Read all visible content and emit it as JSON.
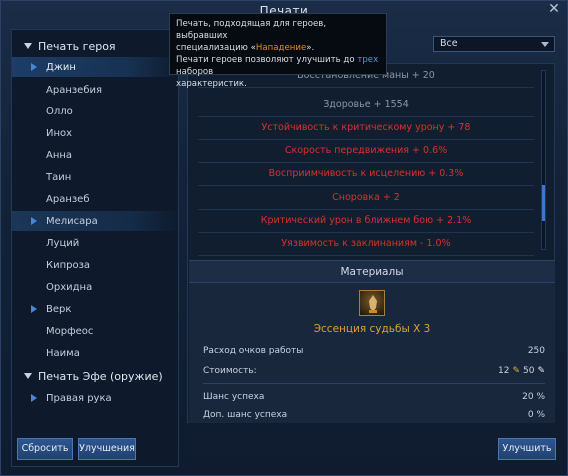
{
  "window": {
    "title": "Печати",
    "close_glyph": "✕"
  },
  "sidebar": {
    "groups": [
      {
        "label": "Печать героя"
      },
      {
        "label": "Печать Эфе (оружие)"
      }
    ],
    "items": [
      {
        "label": "Джин",
        "marked": true,
        "selected": true
      },
      {
        "label": "Аранзебия"
      },
      {
        "label": "Олло"
      },
      {
        "label": "Инох"
      },
      {
        "label": "Анна"
      },
      {
        "label": "Таин"
      },
      {
        "label": "Аранзеб"
      },
      {
        "label": "Мелисара",
        "marked": true
      },
      {
        "label": "Луций"
      },
      {
        "label": "Кипроза"
      },
      {
        "label": "Орхидна"
      },
      {
        "label": "Верк",
        "marked": true
      },
      {
        "label": "Морфеос"
      },
      {
        "label": "Наима"
      },
      {
        "label": "Правая рука",
        "marked": true
      }
    ]
  },
  "filter": {
    "selected": "Все"
  },
  "tooltip": {
    "line1": "Печать, подходящая для героев, выбравших",
    "line2_prefix": "специализацию «",
    "line2_accent": "Нападение",
    "line2_suffix": "».",
    "line3_prefix": "Печати героев позволяют улучшить до ",
    "line3_accent": "трех",
    "line3_suffix": " наборов",
    "line4": "характеристик."
  },
  "stats": [
    {
      "text": "Восстановление маны + 20",
      "tone": "gray"
    },
    {
      "text": "Здоровье + 1554",
      "tone": "gray"
    },
    {
      "text": "Устойчивость к критическому урону + 78",
      "tone": "red"
    },
    {
      "text": "Скорость передвижения + 0.6%",
      "tone": "red"
    },
    {
      "text": "Восприимчивость к исцелению + 0.3%",
      "tone": "red"
    },
    {
      "text": "Сноровка + 2",
      "tone": "red"
    },
    {
      "text": "Критический урон в ближнем бою + 2.1%",
      "tone": "red"
    },
    {
      "text": "Уязвимость к заклинаниям - 1.0%",
      "tone": "red"
    }
  ],
  "materials": {
    "header": "Материалы",
    "icon": "essence-icon",
    "name": "Эссенция судьбы X 3",
    "work_label": "Расход очков работы",
    "work_value": "250",
    "cost_label": "Стоимость:",
    "cost_gold": "12",
    "cost_silver": "50",
    "chance_label": "Шанс успеха",
    "chance_value": "20 %",
    "bonus_label": "Доп. шанс успеха",
    "bonus_value": "0 %"
  },
  "buttons": {
    "reset": "Сбросить",
    "upgrades": "Улучшения",
    "improve": "Улучшить"
  },
  "scroll": {
    "position": 0.8
  },
  "colors": {
    "accent_blue": "#3b78d1",
    "stat_red": "#d6322d",
    "material_gold": "#e0a232"
  }
}
